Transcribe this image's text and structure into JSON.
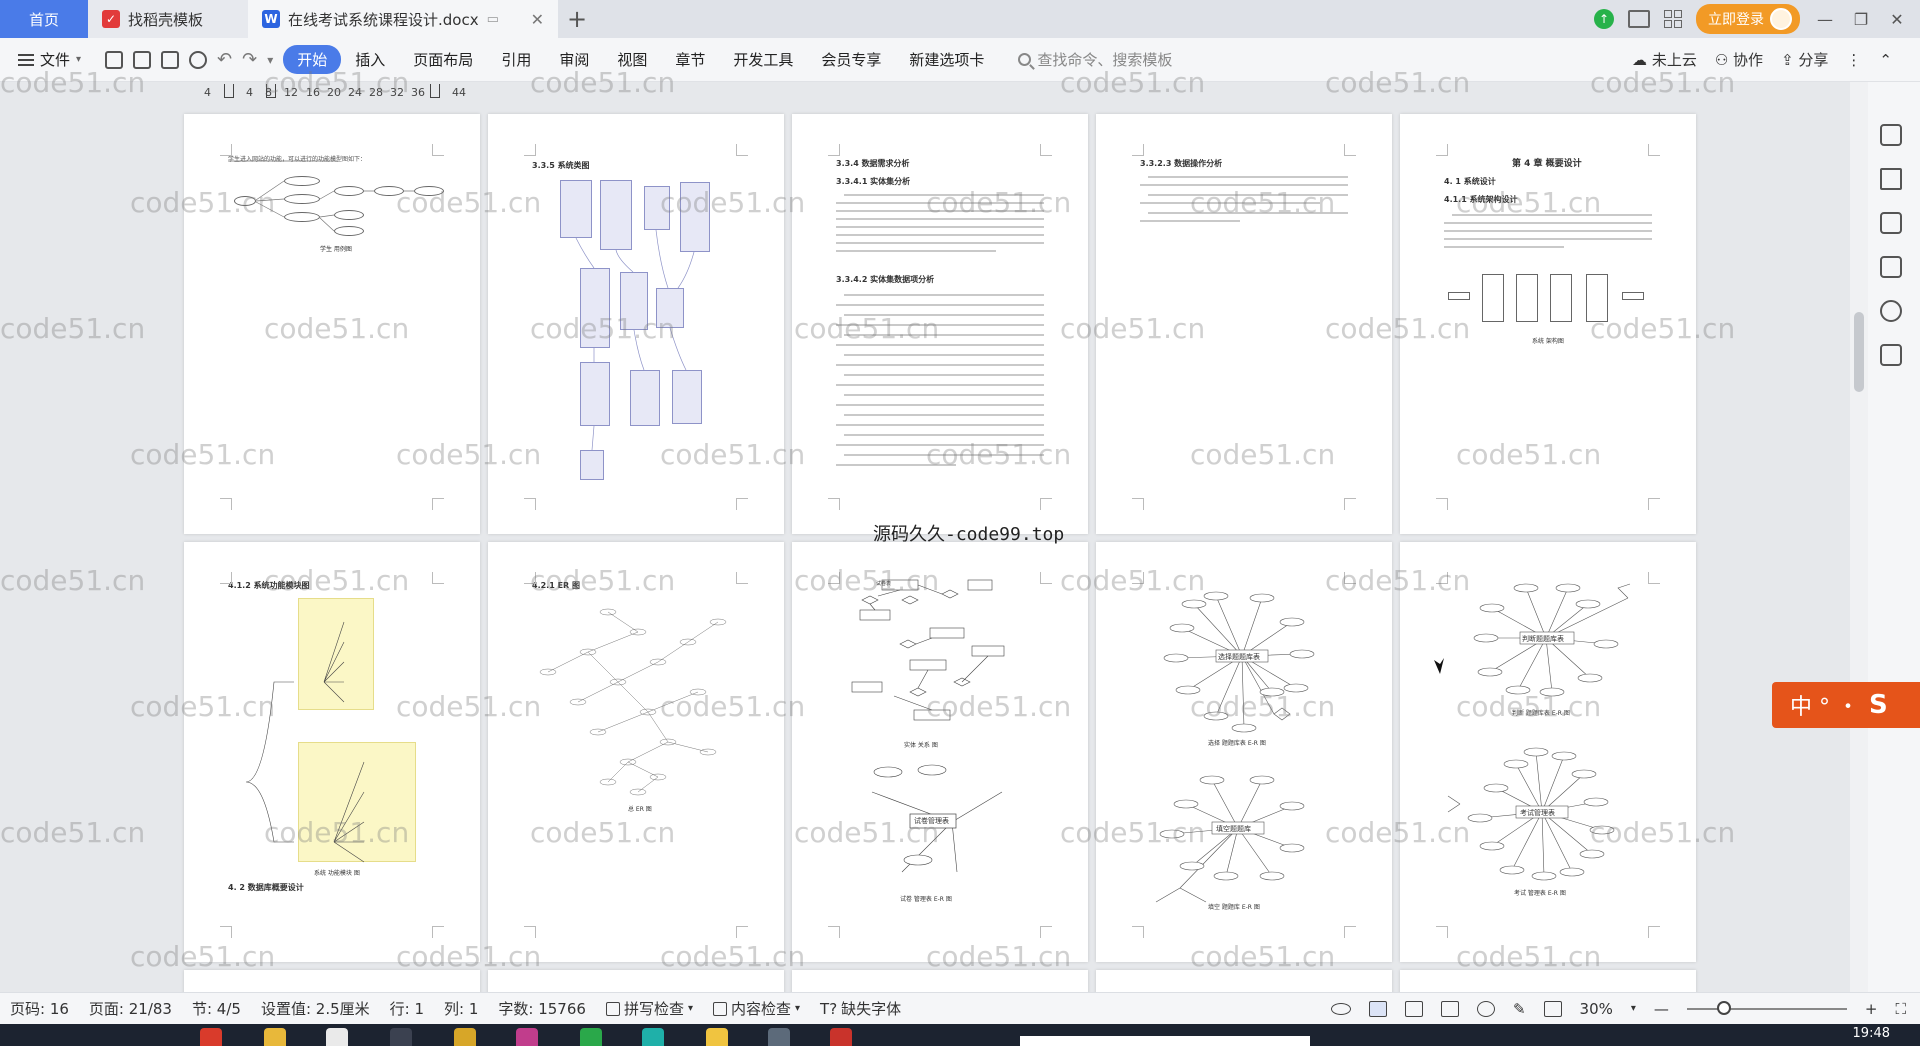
{
  "tabs": {
    "home": "首页",
    "template": "找稻壳模板",
    "document": "在线考试系统课程设计.docx"
  },
  "title_bar": {
    "login_label": "立即登录"
  },
  "ribbon": {
    "file_label": "文件",
    "tabs": [
      "开始",
      "插入",
      "页面布局",
      "引用",
      "审阅",
      "视图",
      "章节",
      "开发工具",
      "会员专享",
      "新建选项卡"
    ],
    "active_tab": "开始",
    "search_placeholder": "查找命令、搜索模板",
    "cloud_label": "未上云",
    "collab_label": "协作",
    "share_label": "分享"
  },
  "ruler": {
    "ticks": [
      "4",
      "4",
      "8",
      "12",
      "16",
      "20",
      "24",
      "28",
      "32",
      "36",
      "44"
    ]
  },
  "watermark": {
    "text": "code51.cn",
    "center_text": "源码久久-code99.top"
  },
  "pages": {
    "p1": {
      "caption": "学生 用例图",
      "intro": "学生进入网站的功能，可以进行的功能模型图如下："
    },
    "p2": {
      "title": "3.3.5 系统类图"
    },
    "p3": {
      "h1": "3.3.4 数据需求分析",
      "h2": "3.3.4.1 实体集分析",
      "h3": "3.3.4.2 实体集数据项分析"
    },
    "p4": {
      "title": "3.3.2.3 数据操作分析"
    },
    "p5": {
      "chapter": "第 4 章 概要设计",
      "h1": "4. 1 系统设计",
      "h2": "4.1.1 系统架构设计",
      "caption": "系统 架构图"
    },
    "p6": {
      "title": "4.1.2 系统功能模块图",
      "caption": "系统 功能模块 图",
      "footer_title": "4. 2 数据库概要设计"
    },
    "p7": {
      "title": "4.2.1 ER 图",
      "caption": "总 ER 图"
    },
    "p8": {
      "entity_top": "试卷表",
      "entity_bottom": "试卷管理表",
      "caption_top": "实体 关系 图",
      "caption_bottom": "试卷 管理表 E-R 图"
    },
    "p9": {
      "entity_top": "选择题题库表",
      "entity_bottom": "填空题题库",
      "caption_top": "选择 题题库表 E-R 图",
      "caption_bottom": "填空 题题库 E-R 图"
    },
    "p10": {
      "entity_top": "判断题题库表",
      "entity_bottom": "考试管理表",
      "caption_top": "判断 题题库表 E-R 图",
      "caption_bottom": "考试 管理表 E-R 图"
    }
  },
  "side_float": {
    "text": "中 ° ・ ",
    "logo": "S"
  },
  "status": {
    "page_code": "页码: 16",
    "page": "页面: 21/83",
    "section": "节: 4/5",
    "setting": "设置值: 2.5厘米",
    "row": "行: 1",
    "col": "列: 1",
    "word_count": "字数: 15766",
    "spell_check": "拼写检查",
    "content_check": "内容检查",
    "missing_font": "缺失字体",
    "zoom": "30%"
  },
  "taskbar": {
    "time": "19:48"
  }
}
